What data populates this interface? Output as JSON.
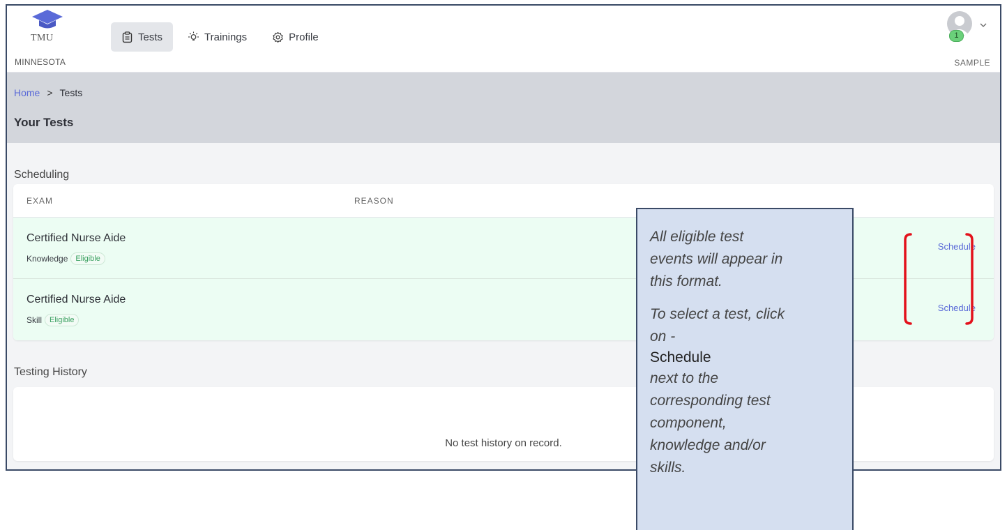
{
  "logo": {
    "line1": "TMU",
    "line2": "MINNESOTA"
  },
  "nav": [
    {
      "label": "Tests",
      "icon": "clipboard-icon",
      "active": true
    },
    {
      "label": "Trainings",
      "icon": "lightbulb-icon",
      "active": false
    },
    {
      "label": "Profile",
      "icon": "gear-icon",
      "active": false
    }
  ],
  "user": {
    "name": "SAMPLE",
    "badge_count": "1"
  },
  "breadcrumb": {
    "home": "Home",
    "separator": ">",
    "current": "Tests"
  },
  "page_title": "Your Tests",
  "scheduling": {
    "label": "Scheduling",
    "columns": [
      "EXAM",
      "REASON"
    ],
    "rows": [
      {
        "title": "Certified Nurse Aide",
        "type": "Knowledge",
        "status": "Eligible",
        "action": "Schedule"
      },
      {
        "title": "Certified Nurse Aide",
        "type": "Skill",
        "status": "Eligible",
        "action": "Schedule"
      }
    ]
  },
  "history": {
    "label": "Testing History",
    "empty_text": "No test history on record."
  },
  "callout": {
    "line1": "All eligible test",
    "line2": "events will appear in",
    "line3": "this format.",
    "line4": "To select a test, click",
    "line5": "on -",
    "line6": "Schedule",
    "line7": "next to the",
    "line8": "corresponding test",
    "line9": "component,",
    "line10": "knowledge and/or",
    "line11": "skills."
  },
  "colors": {
    "accent": "#5a6ad8",
    "eligible_row": "#ecfdf3",
    "annotation": "#e3111b",
    "callout_bg": "#d5dff0"
  }
}
